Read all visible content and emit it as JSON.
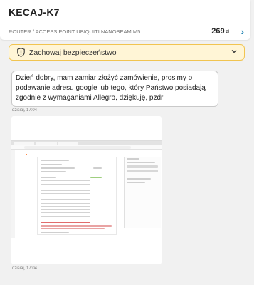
{
  "header": {
    "seller_name": "KECAJ-K7",
    "offer_title": "ROUTER / ACCESS POINT UBIQUITI NANOBEAM M5",
    "price": "269",
    "currency": "zł"
  },
  "security": {
    "label": "Zachowaj bezpieczeństwo"
  },
  "messages": [
    {
      "text": "Dzień dobry, mam zamiar złożyć zamówienie, prosimy o podawanie adresu google lub tego, który Państwo posiadają zgodnie z wymaganiami Allegro, dziękuję, pzdr",
      "time": "dzisiaj, 17:04"
    },
    {
      "type": "image",
      "time": "dzisiaj, 17:04"
    }
  ],
  "colors": {
    "background": "#f1f1f1",
    "security_bg": "#fff5d6",
    "security_border": "#f1c450",
    "accent": "#1a7fb0"
  },
  "icons": [
    "shield-icon",
    "chevron-right-icon",
    "chevron-down-icon"
  ]
}
